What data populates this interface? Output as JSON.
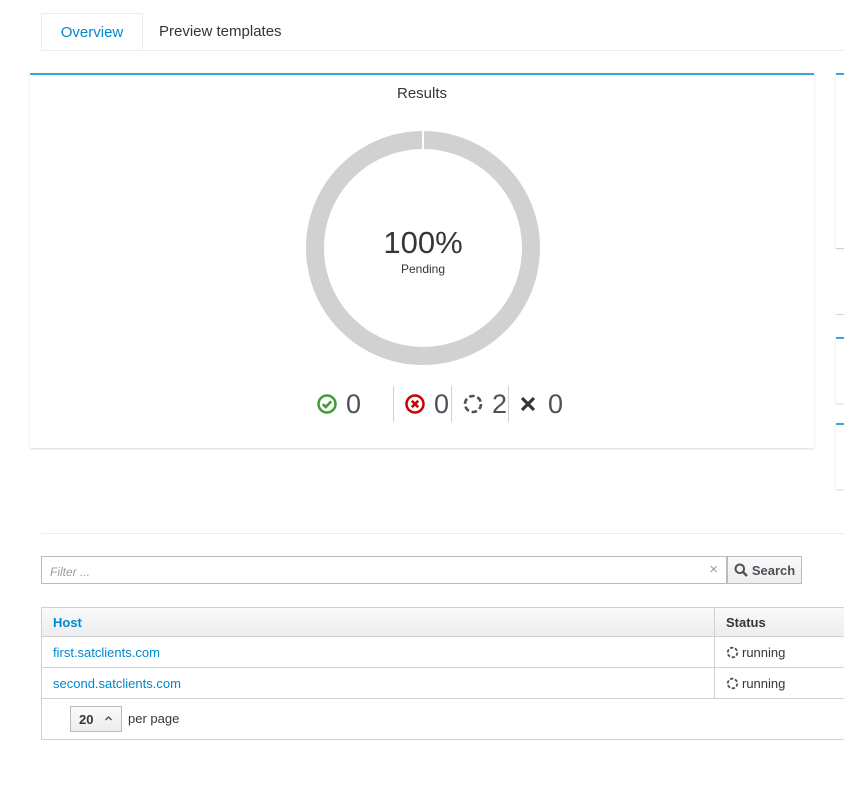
{
  "tabs": [
    {
      "label": "Overview",
      "active": true
    },
    {
      "label": "Preview templates",
      "active": false
    }
  ],
  "results": {
    "title": "Results",
    "percent": "100%",
    "status_label": "Pending",
    "pending_fraction": 1.0,
    "counts": {
      "success": "0",
      "failed": "0",
      "pending": "2",
      "cancelled": "0"
    }
  },
  "filter": {
    "placeholder": "Filter ...",
    "value": "",
    "clear_glyph": "×",
    "search_label": "Search"
  },
  "table": {
    "columns": [
      "Host",
      "Status"
    ],
    "rows": [
      {
        "host": "first.satclients.com",
        "status": "running"
      },
      {
        "host": "second.satclients.com",
        "status": "running"
      }
    ]
  },
  "pagination": {
    "per_page_value": "20",
    "per_page_label": "per page"
  },
  "colors": {
    "accent": "#0088ce",
    "card_border": "#39a5dc",
    "success": "#3f9c35",
    "danger": "#cc0000",
    "donut": "#d1d1d1"
  },
  "icons": {
    "success": "ok-circle-icon",
    "failed": "error-circle-icon",
    "pending": "spinner-icon",
    "cancelled": "close-icon",
    "search": "search-icon",
    "chevron": "chevron-up-icon"
  }
}
